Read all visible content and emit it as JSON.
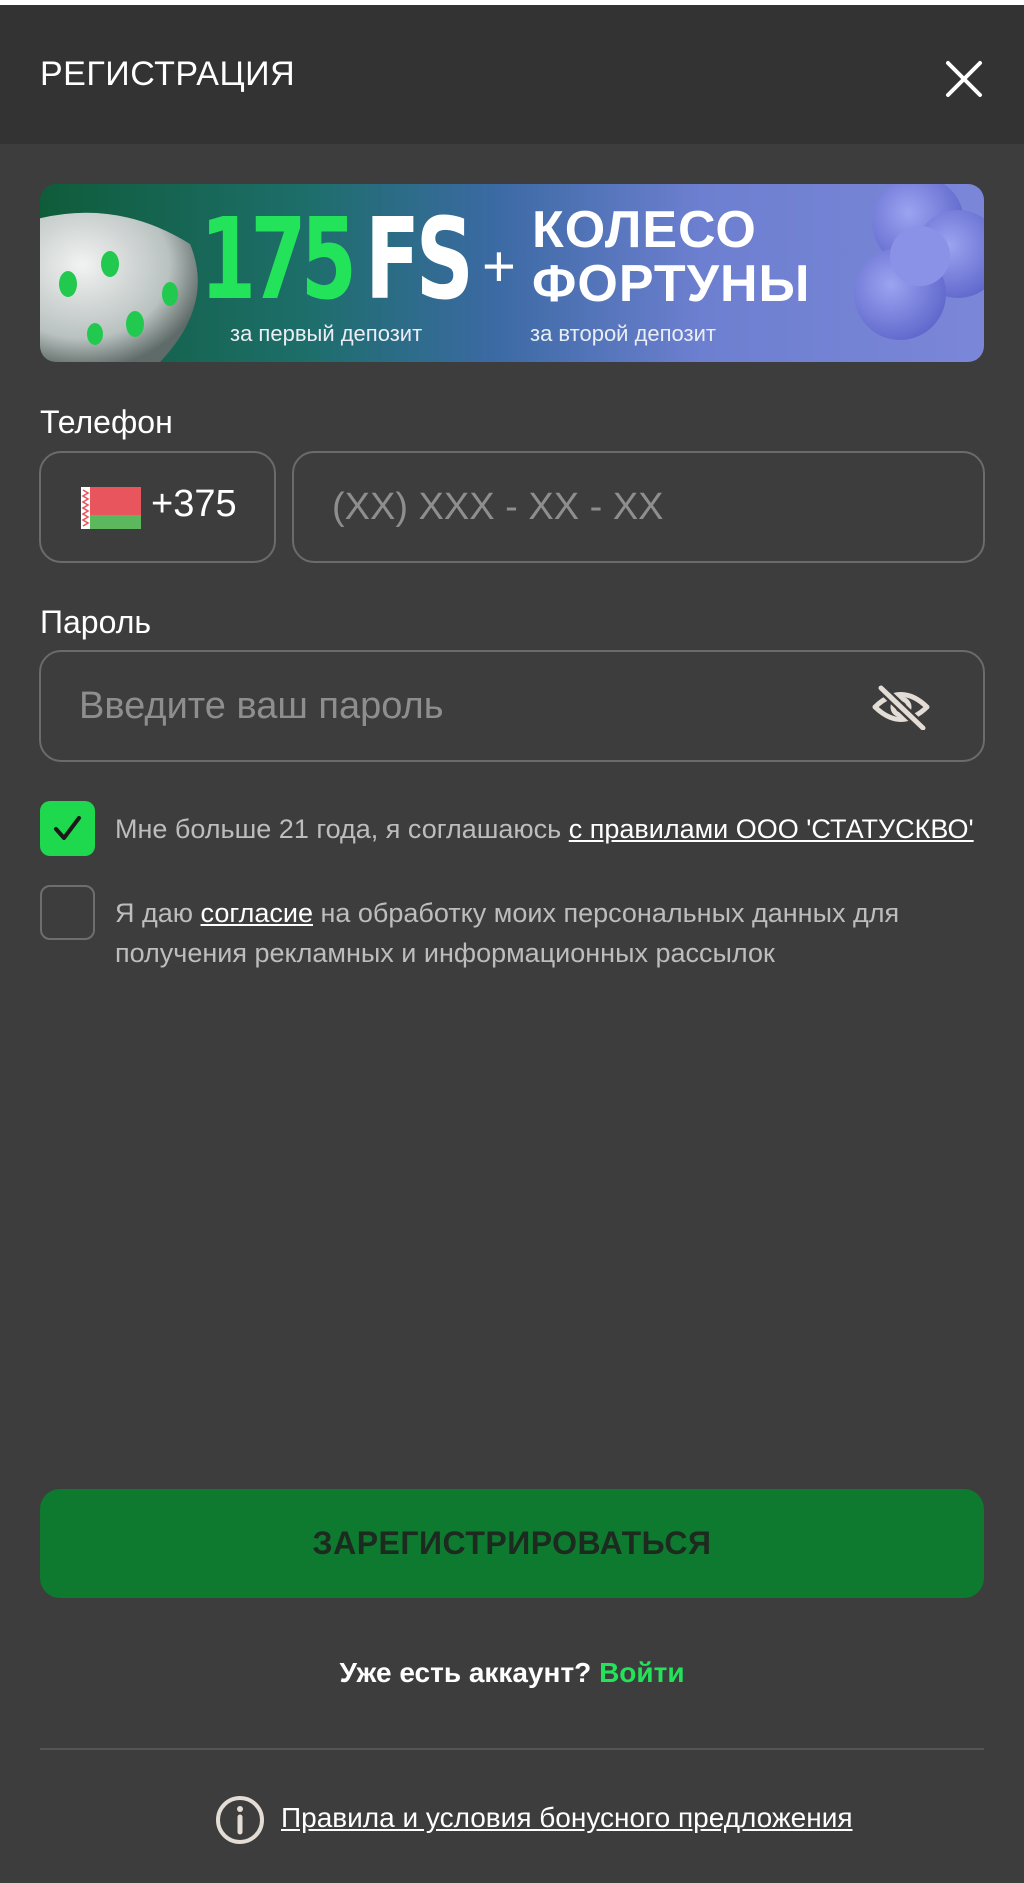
{
  "header": {
    "title": "РЕГИСТРАЦИЯ",
    "close_icon": "close-icon"
  },
  "banner": {
    "number": "175",
    "fs": "FS",
    "plus": "+",
    "wheel_line1": "КОЛЕСО",
    "wheel_line2": "ФОРТУНЫ",
    "sub_first": "за первый депозит",
    "sub_second": "за второй депозит"
  },
  "phone": {
    "label": "Телефон",
    "country_code": "+375",
    "flag_icon": "belarus-flag-icon",
    "placeholder": "(XX) XXX - XX - XX",
    "value": ""
  },
  "password": {
    "label": "Пароль",
    "placeholder": "Введите ваш пароль",
    "value": "",
    "toggle_icon": "eye-off-icon"
  },
  "agreements": {
    "age": {
      "checked": true,
      "text": "Мне больше 21 года, я соглашаюсь ",
      "link": "с правилами ООО 'СТАТУСКВО'"
    },
    "marketing": {
      "checked": false,
      "text_before": "Я даю ",
      "link": "согласие",
      "text_after": " на обработку моих персональных данных для",
      "text_line2": "получения рекламных и информационных рассылок"
    }
  },
  "submit_label": "ЗАРЕГИСТРИРОВАТЬСЯ",
  "login": {
    "question": "Уже есть аккаунт? ",
    "link": "Войти"
  },
  "rules": {
    "icon": "info-icon",
    "link": "Правила и условия бонусного предложения"
  },
  "colors": {
    "background": "#3d3d3d",
    "header": "#333333",
    "accent_green": "#22e35a",
    "checkbox_green": "#1ed84d",
    "button_green": "#0d7a2f"
  }
}
